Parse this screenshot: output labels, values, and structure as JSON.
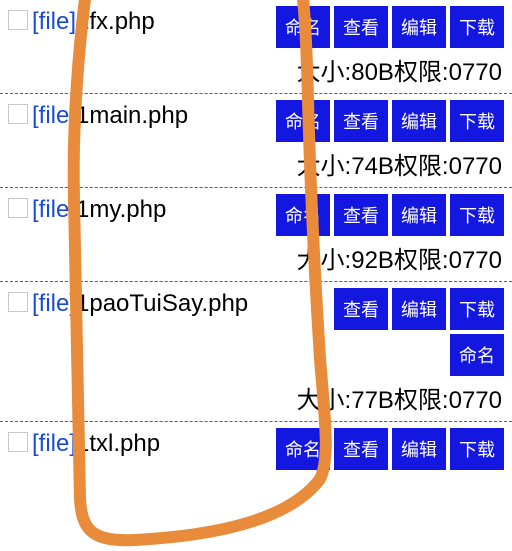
{
  "labels": {
    "type_prefix": "[file]",
    "rename": "命名",
    "view": "查看",
    "edit": "编辑",
    "download": "下载",
    "size": "大小:",
    "perm": "权限:"
  },
  "files": [
    {
      "name": "1fx.php",
      "size": "80B",
      "perm": "0770"
    },
    {
      "name": "1main.php",
      "size": "74B",
      "perm": "0770"
    },
    {
      "name": "1my.php",
      "size": "92B",
      "perm": "0770"
    },
    {
      "name": "1paoTuiSay.php",
      "size": "77B",
      "perm": "0770"
    },
    {
      "name": "1txl.php",
      "size": "",
      "perm": ""
    }
  ]
}
